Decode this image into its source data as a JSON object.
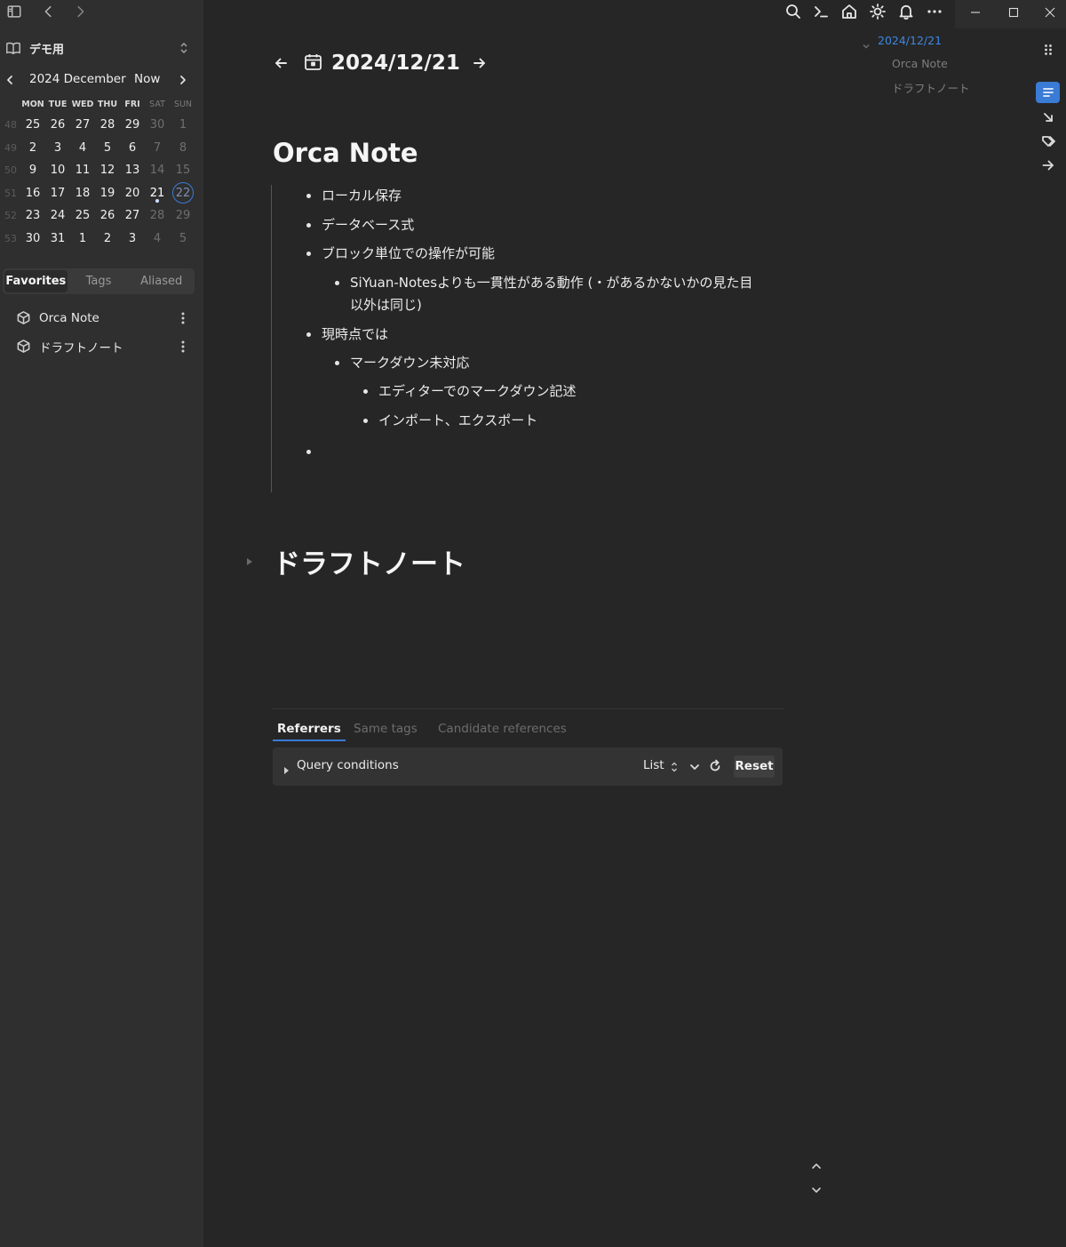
{
  "sidebar": {
    "repo_name": "デモ用",
    "calendar": {
      "month_label": "2024 December",
      "now_label": "Now",
      "weekdays": [
        "MON",
        "TUE",
        "WED",
        "THU",
        "FRI",
        "SAT",
        "SUN"
      ],
      "weeks": [
        {
          "num": "48",
          "days": [
            "25",
            "26",
            "27",
            "28",
            "29",
            "30",
            "1"
          ]
        },
        {
          "num": "49",
          "days": [
            "2",
            "3",
            "4",
            "5",
            "6",
            "7",
            "8"
          ]
        },
        {
          "num": "50",
          "days": [
            "9",
            "10",
            "11",
            "12",
            "13",
            "14",
            "15"
          ]
        },
        {
          "num": "51",
          "days": [
            "16",
            "17",
            "18",
            "19",
            "20",
            "21",
            "22"
          ]
        },
        {
          "num": "52",
          "days": [
            "23",
            "24",
            "25",
            "26",
            "27",
            "28",
            "29"
          ]
        },
        {
          "num": "53",
          "days": [
            "30",
            "31",
            "1",
            "2",
            "3",
            "4",
            "5"
          ]
        }
      ],
      "today": "21",
      "selected": "22",
      "accent_color": "#3a7bd5"
    },
    "tabs": [
      "Favorites",
      "Tags",
      "Aliased"
    ],
    "active_tab": "Favorites",
    "favorites": [
      "Orca Note",
      "ドラフトノート"
    ]
  },
  "topbar": {
    "icons": [
      "search-icon",
      "command-icon",
      "home-icon",
      "sun-icon",
      "bell-icon",
      "more-icon"
    ],
    "window_controls": [
      "minimize-icon",
      "maximize-icon",
      "close-icon"
    ]
  },
  "journal": {
    "date": "2024/12/21"
  },
  "blocks": [
    {
      "title": "Orca Note",
      "items": [
        {
          "text": "ローカル保存",
          "level": 0
        },
        {
          "text": "データベース式",
          "level": 0
        },
        {
          "text": "ブロック単位での操作が可能",
          "level": 0
        },
        {
          "text": "SiYuan-Notesよりも一貫性がある動作 (・があるかないかの見た目",
          "level": 1
        },
        {
          "text": "以外は同じ)",
          "level": 1,
          "continuation": true
        },
        {
          "text": "現時点では",
          "level": 0
        },
        {
          "text": "マークダウン未対応",
          "level": 1
        },
        {
          "text": "エディターでのマークダウン記述",
          "level": 2
        },
        {
          "text": "インポート、エクスポート",
          "level": 2
        },
        {
          "text": "",
          "level": 0
        }
      ]
    },
    {
      "title": "ドラフトノート"
    }
  ],
  "references": {
    "tabs": [
      "Referrers",
      "Same tags",
      "Candidate references"
    ],
    "active_tab": "Referrers",
    "query_label": "Query conditions",
    "view_mode": "List",
    "reset_label": "Reset"
  },
  "outline": {
    "root": "2024/12/21",
    "children": [
      "Orca Note",
      "ドラフトノート"
    ]
  }
}
